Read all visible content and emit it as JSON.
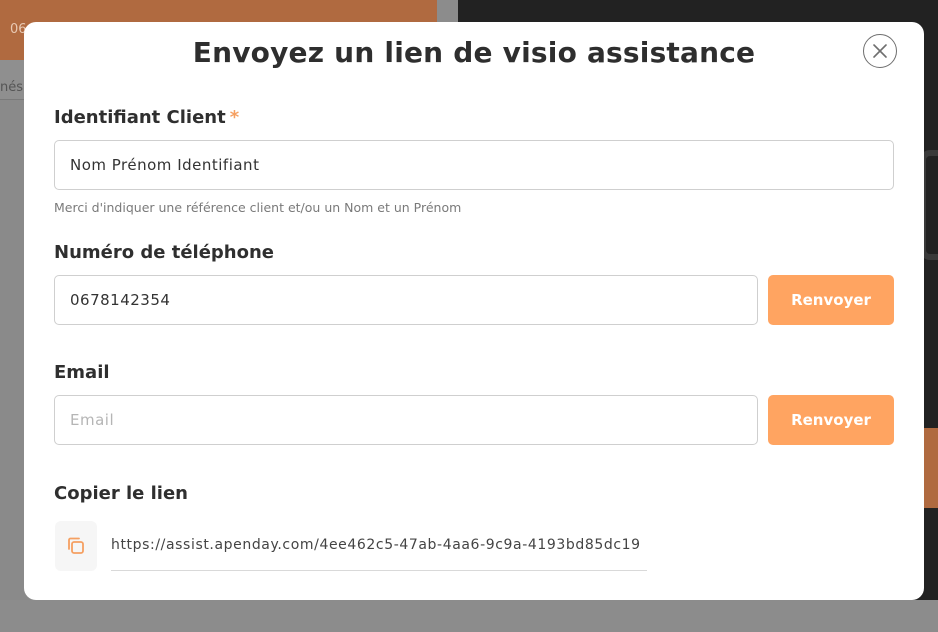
{
  "background": {
    "top_left_text": "06",
    "left_strip_text": "nés"
  },
  "modal": {
    "title": "Envoyez un lien de visio assistance",
    "close_icon": "close-circle-icon"
  },
  "client": {
    "label": "Identifiant Client",
    "required_mark": "*",
    "value": "Nom Prénom Identifiant",
    "placeholder": "",
    "hint": "Merci d'indiquer une référence client et/ou un Nom et un Prénom"
  },
  "phone": {
    "label": "Numéro de téléphone",
    "value": "0678142354",
    "button_label": "Renvoyer"
  },
  "email": {
    "label": "Email",
    "value": "",
    "placeholder": "Email",
    "button_label": "Renvoyer"
  },
  "link": {
    "label": "Copier le lien",
    "url": "https://assist.apenday.com/4ee462c5-47ab-4aa6-9c9a-4193bd85dc19",
    "copy_icon": "copy-icon"
  },
  "colors": {
    "accent": "#ffa461",
    "required": "#f5a062",
    "title": "#2e2e2e"
  }
}
